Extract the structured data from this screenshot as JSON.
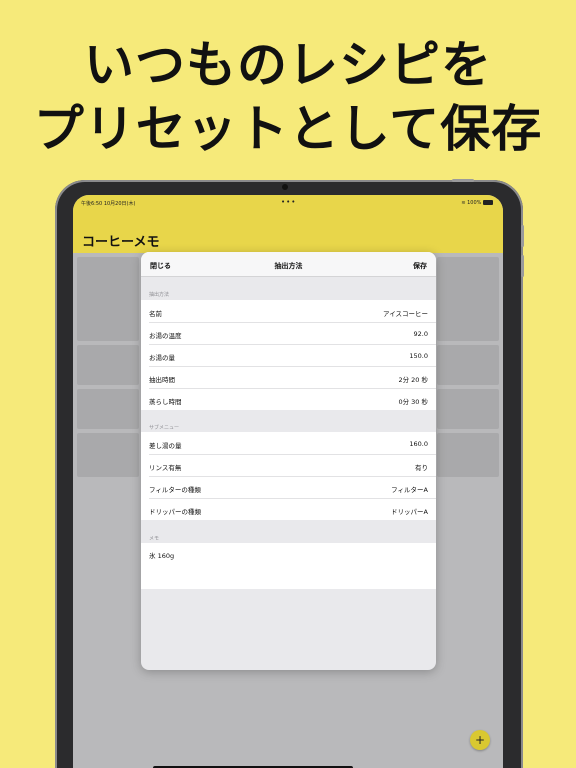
{
  "headline": {
    "line1": "いつものレシピを",
    "line2": "プリセットとして保存"
  },
  "status_bar": {
    "time": "午後6:50  10月20日(木)",
    "dots": "•••",
    "battery": "100%"
  },
  "app": {
    "title": "コーヒーメモ",
    "fab_label": "+"
  },
  "sheet": {
    "close_label": "閉じる",
    "title": "抽出方法",
    "save_label": "保存",
    "sections": [
      {
        "header": "抽出方法",
        "rows": [
          {
            "label": "名前",
            "value": "アイスコーヒー"
          },
          {
            "label": "お湯の温度",
            "value": "92.0"
          },
          {
            "label": "お湯の量",
            "value": "150.0"
          },
          {
            "label": "抽出時間",
            "value": "2分 20 秒"
          },
          {
            "label": "蒸らし時間",
            "value": "0分 30 秒"
          }
        ]
      },
      {
        "header": "サブメニュー",
        "rows": [
          {
            "label": "差し湯の量",
            "value": "160.0"
          },
          {
            "label": "リンス有無",
            "value": "有り"
          },
          {
            "label": "フィルターの種類",
            "value": "フィルターA"
          },
          {
            "label": "ドリッパーの種類",
            "value": "ドリッパーA"
          }
        ]
      }
    ],
    "memo": {
      "header": "メモ",
      "text": "氷 160g"
    }
  },
  "colors": {
    "background": "#f6ea7a",
    "nav_bar": "#e8d64a",
    "fab": "#d9c831"
  }
}
